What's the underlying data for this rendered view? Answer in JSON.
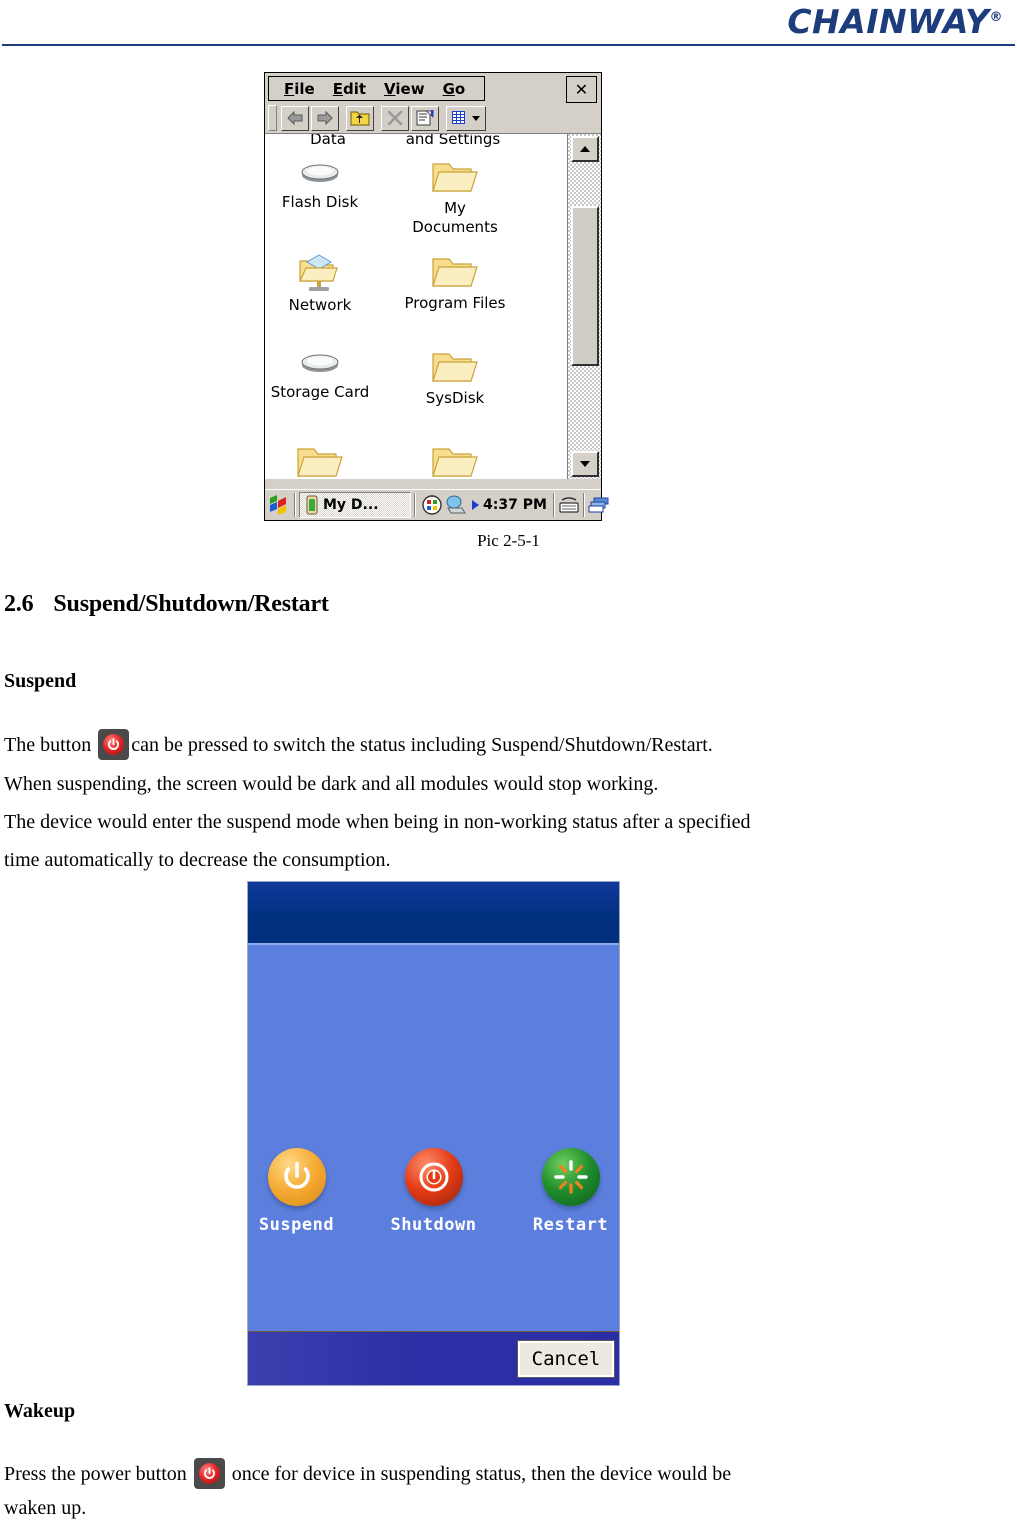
{
  "brand": {
    "name": "CHAINWAY",
    "registered_mark": "®"
  },
  "explorer_screenshot": {
    "menu": {
      "items": [
        {
          "label": "File",
          "accel": "F"
        },
        {
          "label": "Edit",
          "accel": "E"
        },
        {
          "label": "View",
          "accel": "V"
        },
        {
          "label": "Go",
          "accel": "G"
        }
      ],
      "close_label": "✕"
    },
    "toolbar": {
      "buttons": [
        "back-arrow-icon",
        "forward-arrow-icon",
        "up-folder-icon",
        "delete-icon",
        "properties-icon",
        "view-list-dropdown-icon"
      ]
    },
    "clipped_row": {
      "left_text": "Data",
      "right_text": "and Settings"
    },
    "icons": [
      {
        "label": "Flash Disk",
        "icon": "disk-drive-icon"
      },
      {
        "label": "My\nDocuments",
        "label_line1": "My",
        "label_line2": "Documents",
        "icon": "folder-icon"
      },
      {
        "label": "Network",
        "icon": "network-folder-icon"
      },
      {
        "label": "Program Files",
        "icon": "folder-icon"
      },
      {
        "label": "Storage Card",
        "icon": "disk-drive-icon"
      },
      {
        "label": "SysDisk",
        "icon": "folder-icon"
      },
      {
        "label": "",
        "icon": "folder-icon"
      },
      {
        "label": "",
        "icon": "folder-icon"
      }
    ],
    "scrollbar": {
      "up_arrow": "scroll-up-icon",
      "down_arrow": "scroll-down-icon"
    },
    "taskbar": {
      "start_icon": "windows-start-icon",
      "task_label": "My D...",
      "task_icon": "device-icon",
      "tray_icons": [
        "tray-grid-icon",
        "tray-desktop-icon",
        "tray-arrow-icon"
      ],
      "clock": "4:37 PM",
      "keyboard_icon": "keyboard-icon",
      "switch_icon": "window-switch-icon"
    }
  },
  "caption_1": "Pic 2-5-1",
  "section": {
    "number": "2.6",
    "title": "Suspend/Shutdown/Restart"
  },
  "suspend": {
    "heading": "Suspend",
    "line1_before": "The button",
    "line1_after": "can be pressed to switch the status including Suspend/Shutdown/Restart.",
    "line2": "When suspending, the screen would be dark and all modules would stop working.",
    "line3": "The device would enter the suspend mode when being in non-working status after a specified",
    "line4": "time automatically to decrease the consumption.",
    "power_icon": "power-button-icon"
  },
  "dialog_screenshot": {
    "options": [
      {
        "label": "Suspend",
        "icon": "power-suspend-icon",
        "color": "#f6ab33"
      },
      {
        "label": "Shutdown",
        "icon": "power-shutdown-icon",
        "color": "#e33b16"
      },
      {
        "label": "Restart",
        "icon": "restart-icon",
        "color": "#1f8d2c"
      }
    ],
    "cancel_label": "Cancel",
    "header_color": "#00307f",
    "body_color": "#5c7fdd",
    "footer_color": "#2d2fa6"
  },
  "wakeup": {
    "heading": "Wakeup",
    "line1_before": "Press the power button",
    "line1_after": "once for device in suspending status, then the device would be",
    "line2": "waken up.",
    "power_icon": "power-button-icon"
  }
}
